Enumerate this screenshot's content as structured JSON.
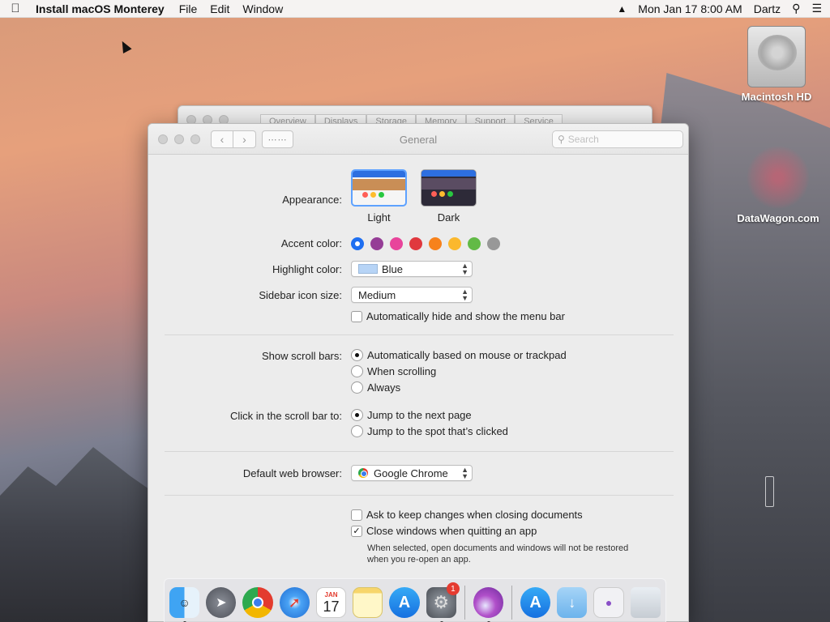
{
  "menubar": {
    "app_name": "Install macOS Monterey",
    "items": [
      "File",
      "Edit",
      "Window"
    ],
    "clock": "Mon Jan 17  8:00 AM",
    "user": "Dartz"
  },
  "desktop": {
    "icons": [
      {
        "label": "Macintosh HD"
      },
      {
        "label": "DataWagon.com"
      }
    ]
  },
  "back_window": {
    "tabs": [
      "Overview",
      "Displays",
      "Storage",
      "Memory",
      "Support",
      "Service"
    ]
  },
  "window": {
    "title": "General",
    "search_placeholder": "Search"
  },
  "general": {
    "appearance_label": "Appearance:",
    "appearance_options": [
      "Light",
      "Dark"
    ],
    "accent_label": "Accent color:",
    "accent_colors": [
      "#1e6ff1",
      "#953d96",
      "#e8449b",
      "#e0383e",
      "#f7821b",
      "#fbb82d",
      "#62ba46",
      "#989898"
    ],
    "highlight_label": "Highlight color:",
    "highlight_value": "Blue",
    "sidebar_label": "Sidebar icon size:",
    "sidebar_value": "Medium",
    "auto_hide_menu": "Automatically hide and show the menu bar",
    "scrollbars_label": "Show scroll bars:",
    "scrollbar_options": [
      "Automatically based on mouse or trackpad",
      "When scrolling",
      "Always"
    ],
    "click_label": "Click in the scroll bar to:",
    "click_options": [
      "Jump to the next page",
      "Jump to the spot that’s clicked"
    ],
    "browser_label": "Default web browser:",
    "browser_value": "Google Chrome",
    "ask_keep": "Ask to keep changes when closing documents",
    "close_windows": "Close windows when quitting an app",
    "note_line1": "When selected, open documents and windows will not be restored",
    "note_line2": "when you re-open an app."
  },
  "dock": {
    "icons": [
      "finder-icon",
      "launchpad-icon",
      "chrome-icon",
      "safari-icon",
      "calendar-icon",
      "notes-icon",
      "app-store-icon",
      "system-preferences-icon",
      "installer-icon",
      "app-store-folder-icon",
      "downloads-icon",
      "documents-icon",
      "trash-icon"
    ],
    "calendar_month": "JAN",
    "calendar_day": "17",
    "prefs_badge": "1"
  }
}
